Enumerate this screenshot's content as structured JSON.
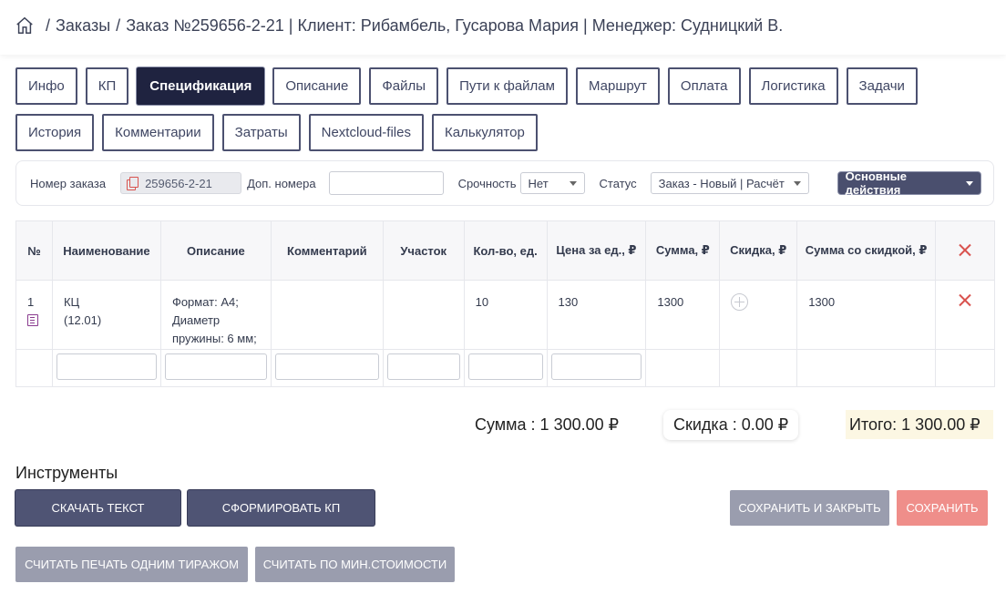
{
  "breadcrumb": {
    "sep": "/",
    "orders": "Заказы",
    "order": "Заказ №259656-2-21 | Клиент: Рибамбель, Гусарова Мария | Менеджер: Судницкий В."
  },
  "tabs_row1": [
    {
      "label": "Инфо"
    },
    {
      "label": "КП"
    },
    {
      "label": "Спецификация"
    },
    {
      "label": "Описание"
    },
    {
      "label": "Файлы"
    },
    {
      "label": "Пути к файлам"
    },
    {
      "label": "Маршрут"
    },
    {
      "label": "Оплата"
    },
    {
      "label": "Логистика"
    },
    {
      "label": "Задачи"
    }
  ],
  "tabs_row2": [
    {
      "label": "История"
    },
    {
      "label": "Комментарии"
    },
    {
      "label": "Затраты"
    },
    {
      "label": "Nextcloud-files"
    },
    {
      "label": "Калькулятор"
    }
  ],
  "active_tab": "Спецификация",
  "filters": {
    "order_number_label": "Номер заказа",
    "order_number": "259656-2-21",
    "extra_numbers_label": "Доп. номера",
    "urgency_label": "Срочность",
    "urgency_value": "Нет",
    "status_label": "Статус",
    "status_value": "Заказ - Новый | Расчёт",
    "actions_label": "Основные действия"
  },
  "table": {
    "headers": [
      "№",
      "Наименование",
      "Описание",
      "Комментарий",
      "Участок",
      "Кол-во, ед.",
      "Цена за ед., ₽",
      "Сумма, ₽",
      "Скидка, ₽",
      "Сумма со скидкой, ₽"
    ],
    "row": {
      "num": "1",
      "name_line1": "КЦ",
      "name_line2": "(12.01)",
      "description": "Формат: А4; Диаметр пружины: 6 мм;",
      "comment": "",
      "section": "",
      "qty": "10",
      "price": "130",
      "sum": "1300",
      "discounted_sum": "1300"
    }
  },
  "totals": {
    "sum": "Сумма : 1 300.00 ₽",
    "discount": "Скидка : 0.00 ₽",
    "total": "Итого: 1 300.00 ₽"
  },
  "tools": {
    "title": "Инструменты",
    "download_text": "Скачать текст",
    "make_kp": "Сформировать КП",
    "save_close": "Сохранить и закрыть",
    "save": "Сохранить",
    "calc_one_run": "Считать печать одним тиражом",
    "calc_min_cost": "Считать по мин.стоимости"
  }
}
